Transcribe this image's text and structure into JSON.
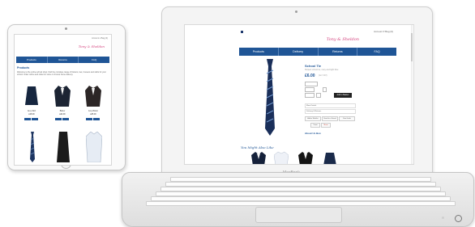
{
  "colors": {
    "accent": "#1f5596",
    "brand_pink": "#d23a78"
  },
  "tablet": {
    "account_text": "Account ▾   Bag (0)",
    "logo_text": "Tony & Sheldon",
    "nav": [
      "Products",
      "Returns",
      "FAQ"
    ],
    "title": "Products",
    "intro": "Welcome to the online school shop. Find the complete range of blazers, ties, trousers and skirts for your school. Order online and collect in store or choose home delivery.",
    "products": [
      {
        "name": "Grey Skirt",
        "price": "£18.00",
        "icon": "skirt-icon"
      },
      {
        "name": "Blazer",
        "price": "£42.00",
        "icon": "blazer-icon"
      },
      {
        "name": "Grey Blazer",
        "price": "£45.00",
        "icon": "blazer-icon"
      },
      {
        "name": "",
        "price": "",
        "icon": "tie-icon"
      },
      {
        "name": "",
        "price": "",
        "icon": "skirt-icon"
      },
      {
        "name": "",
        "price": "",
        "icon": "shirt-icon"
      }
    ]
  },
  "laptop": {
    "account_text": "Account ▾      Bag (0)",
    "logo_text": "Tony & Sheldon",
    "nav": [
      "Products",
      "Delivery",
      "Returns",
      "FAQ"
    ],
    "product_title": "School Tie",
    "product_subtitle": "Striped school tie, navy and light blue",
    "price": "£6.00",
    "price_note": "(Incl. VAT)",
    "add_button": "Add to Basket",
    "rows": [
      "More Details",
      "Delivery & Returns"
    ],
    "pills": [
      "Add to Wishlist",
      "Email to a Friend",
      "Size Guide"
    ],
    "share": [
      "Tweet",
      "Share"
    ],
    "also": "About Us Box",
    "may_like": "You Might Also Like",
    "brand": "MacBook"
  }
}
